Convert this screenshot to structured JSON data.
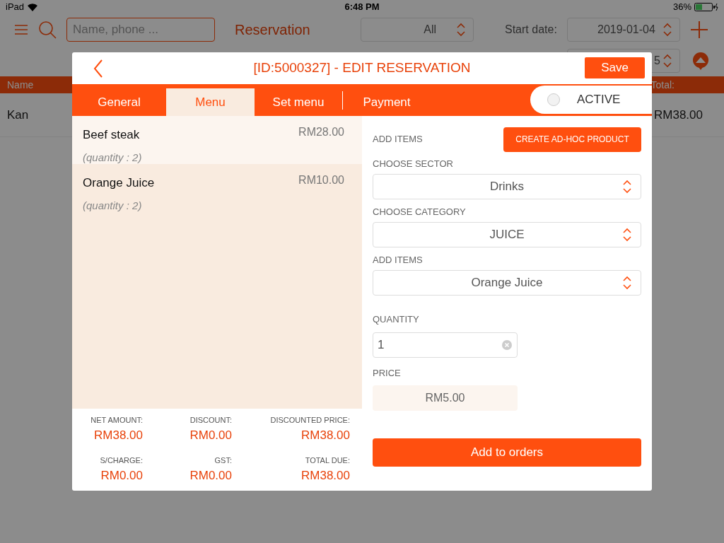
{
  "status_bar": {
    "device": "iPad",
    "time": "6:48 PM",
    "battery": "36%"
  },
  "toolbar": {
    "search_placeholder": "Name, phone ...",
    "title": "Reservation",
    "filter": "All",
    "start_date_label": "Start date:",
    "start_date": "2019-01-04",
    "end_date": "5"
  },
  "table": {
    "columns": [
      "Name",
      "Total:"
    ],
    "rows": [
      {
        "name": "Kan",
        "total": "RM38.00"
      }
    ]
  },
  "dialog": {
    "title": "[ID:5000327] - EDIT RESERVATION",
    "save": "Save",
    "tabs": [
      {
        "label": "General",
        "selected": false
      },
      {
        "label": "Menu",
        "selected": true
      },
      {
        "label": "Set menu",
        "selected": false
      },
      {
        "label": "Payment",
        "selected": false
      }
    ],
    "active_toggle": {
      "label": "ACTIVE",
      "on": false
    },
    "order_items": [
      {
        "name": "Beef steak",
        "price": "RM28.00",
        "quantity": "(quantity : 2)",
        "selected": true
      },
      {
        "name": "Orange Juice",
        "price": "RM10.00",
        "quantity": "(quantity : 2)",
        "selected": false
      }
    ],
    "summary": [
      {
        "label": "NET AMOUNT:",
        "value": "RM38.00"
      },
      {
        "label": "DISCOUNT:",
        "value": "RM0.00"
      },
      {
        "label": "DISCOUNTED PRICE:",
        "value": "RM38.00"
      },
      {
        "label": "S/CHARGE:",
        "value": "RM0.00"
      },
      {
        "label": "GST:",
        "value": "RM0.00"
      },
      {
        "label": "TOTAL DUE:",
        "value": "RM38.00"
      }
    ],
    "add_items_label": "ADD ITEMS",
    "create_button": "CREATE AD-HOC PRODUCT",
    "selects": [
      {
        "label": "CHOOSE SECTOR",
        "value": "Drinks"
      },
      {
        "label": "CHOOSE CATEGORY",
        "value": "JUICE"
      },
      {
        "label": "ADD ITEMS",
        "value": "Orange Juice"
      }
    ],
    "quantity": {
      "label": "QUANTITY",
      "value": "1"
    },
    "price": {
      "label": "PRICE",
      "value": "RM5.00"
    },
    "add_button": "Add to orders"
  }
}
